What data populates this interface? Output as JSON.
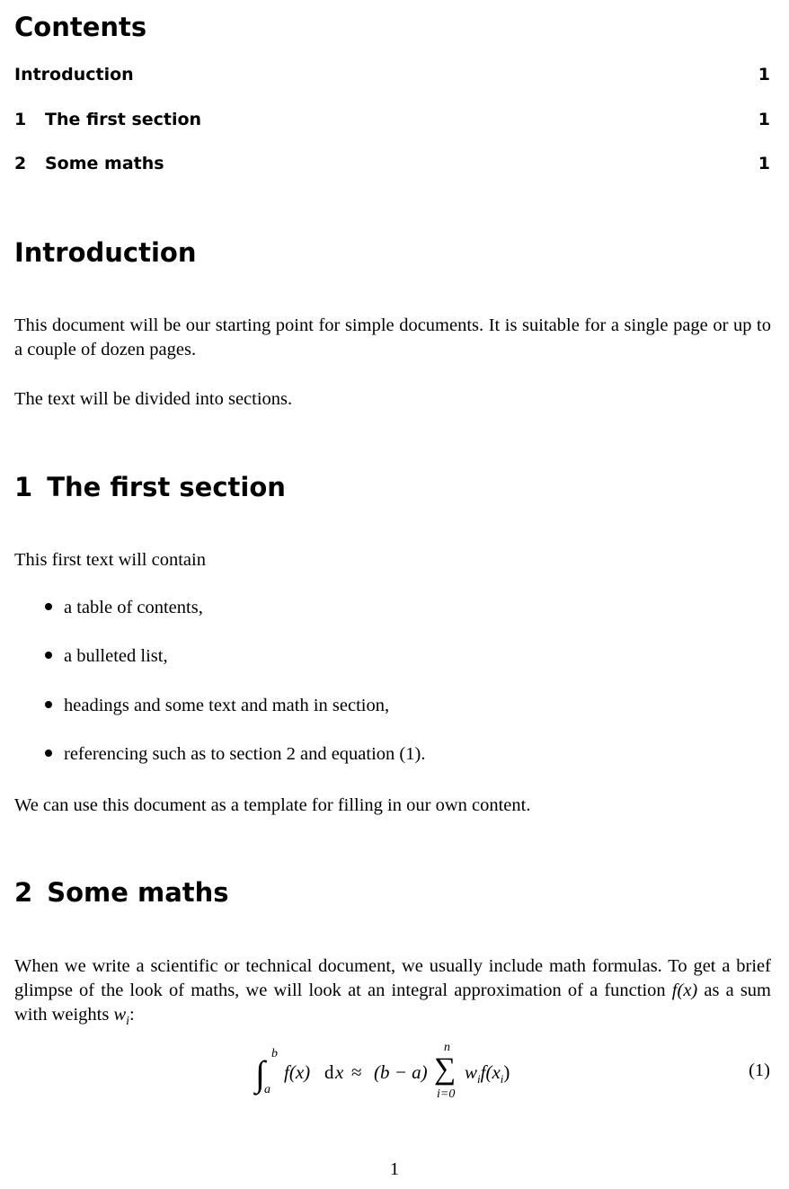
{
  "toc": {
    "title": "Contents",
    "entries": [
      {
        "number": "",
        "label": "Introduction",
        "page": "1"
      },
      {
        "number": "1",
        "label": "The first section",
        "page": "1"
      },
      {
        "number": "2",
        "label": "Some maths",
        "page": "1"
      }
    ]
  },
  "introduction": {
    "title": "Introduction",
    "paragraphs": [
      "This document will be our starting point for simple documents. It is suitable for a single page or up to a couple of dozen pages.",
      "The text will be divided into sections."
    ]
  },
  "section1": {
    "number": "1",
    "title": "The first section",
    "intro": "This first text will contain",
    "bullets": [
      "a table of contents,",
      "a bulleted list,",
      "headings and some text and math in section,",
      "referencing such as to section 2 and equation (1)."
    ],
    "closing": "We can use this document as a template for filling in our own content."
  },
  "section2": {
    "number": "2",
    "title": "Some maths",
    "para_part1": "When we write a scientific or technical document, we usually include math formulas. To get a brief glimpse of the look of maths, we will look at an integral approximation of a function ",
    "para_math1": "f(x)",
    "para_part2": " as a sum with weights ",
    "para_math2_base": "w",
    "para_math2_sub": "i",
    "para_part3": ":",
    "equation": {
      "integral_upper": "b",
      "integral_lower": "a",
      "integrand": "f(x)",
      "differential": "d",
      "differential_var": "x",
      "approx": "≈",
      "factor": "(b − a)",
      "sum_upper": "n",
      "sum_lower": "i=0",
      "summand": "w",
      "summand_sub": "i",
      "summand_rest": "f(x",
      "summand_rest_sub": "i",
      "summand_close": ")",
      "number": "(1)"
    }
  },
  "page_number": "1"
}
